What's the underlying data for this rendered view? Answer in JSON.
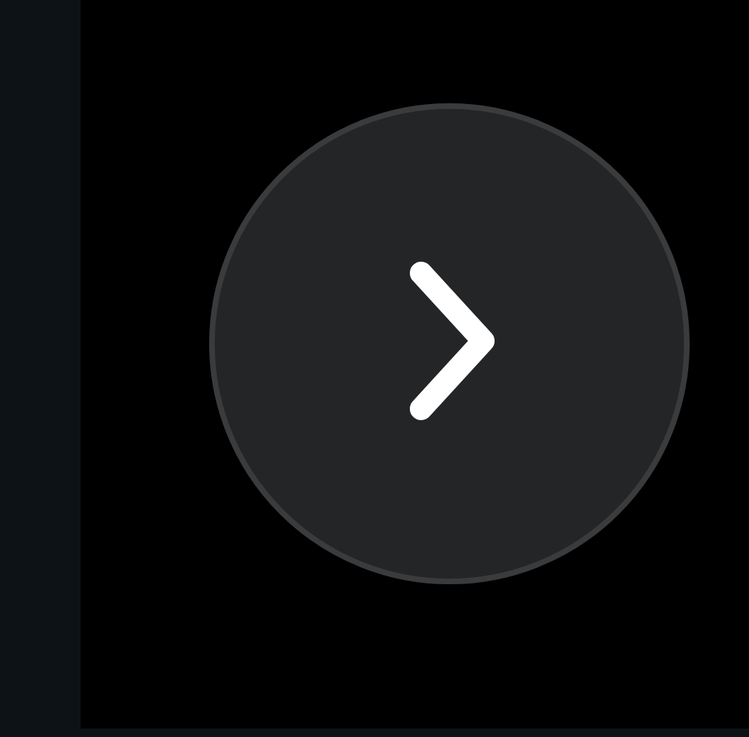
{
  "carousel": {
    "next_button": {
      "disabled": false
    }
  }
}
